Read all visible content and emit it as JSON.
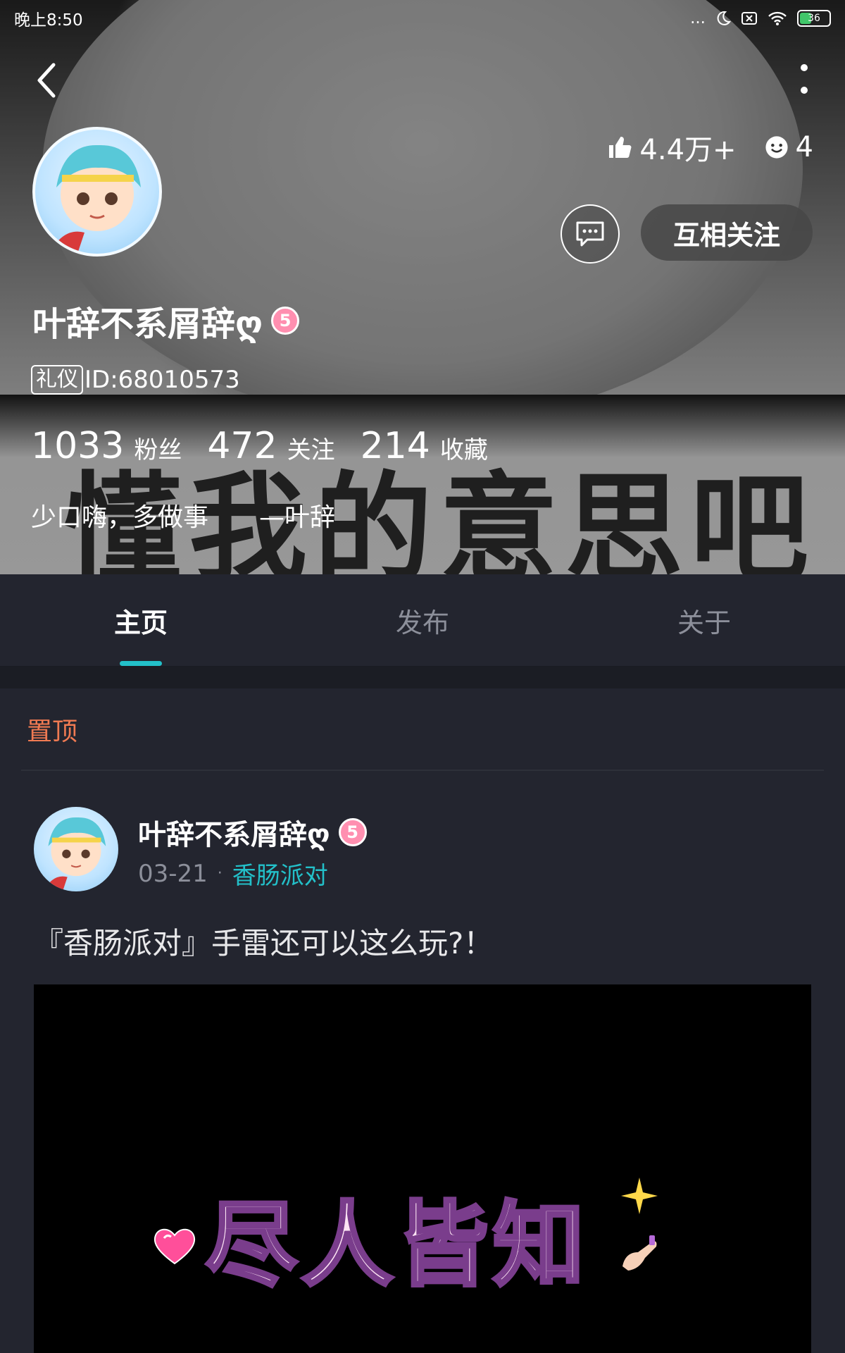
{
  "status_bar": {
    "time": "晚上8:50",
    "dots": "...",
    "battery": "36"
  },
  "profile": {
    "name": "叶辞不系屑辞ღ",
    "level": "5",
    "tag": "礼仪",
    "id_text": "ID:68010573",
    "likes": "4.4万+",
    "emoji_count": "4",
    "follow_button": "互相关注",
    "fans_count": "1033",
    "fans_label": "粉丝",
    "following_count": "472",
    "following_label": "关注",
    "favorites_count": "214",
    "favorites_label": "收藏",
    "bio": "少口嗨，多做事　　—叶辞",
    "banner_caption": "懂我的意思吧"
  },
  "tabs": [
    {
      "label": "主页",
      "active": true
    },
    {
      "label": "发布",
      "active": false
    },
    {
      "label": "关于",
      "active": false
    }
  ],
  "pinned_label": "置顶",
  "post": {
    "author": "叶辞不系屑辞ღ",
    "level": "5",
    "date": "03-21",
    "separator": "·",
    "topic": "香肠派对",
    "title": "『香肠派对』手雷还可以这么玩?！",
    "media_caption": "尽人皆知"
  },
  "colors": {
    "accent": "#23c0c9",
    "pinned": "#f07a52",
    "background": "#23252f"
  }
}
